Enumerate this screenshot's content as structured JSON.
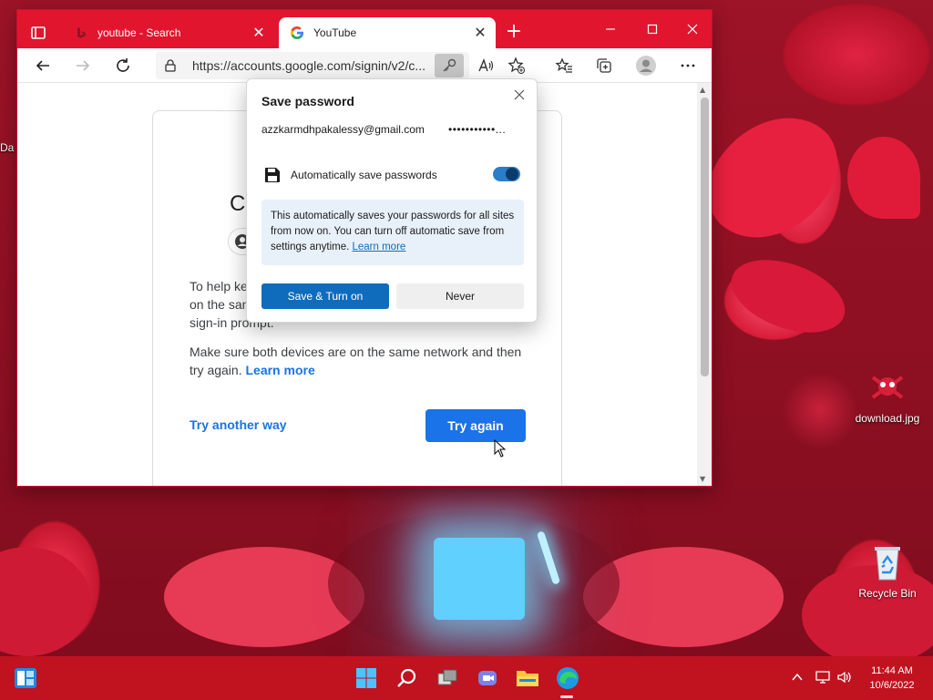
{
  "desktop": {
    "icons": [
      {
        "label": "download.jpg"
      },
      {
        "label": "Recycle Bin"
      }
    ],
    "edge_label": "Da"
  },
  "browser": {
    "tabs": [
      {
        "title": "youtube - Search",
        "favicon": "bing-favicon",
        "active": false
      },
      {
        "title": "YouTube",
        "favicon": "google-favicon",
        "active": true
      }
    ],
    "address": {
      "url": "https://accounts.google.com/signin/v2/c..."
    }
  },
  "page": {
    "heading_partial": "C",
    "para1_lines": [
      "To help ke",
      "on the san",
      "sign-in prompt."
    ],
    "para2_text": "Make sure both devices are on the same network and then try again.",
    "para2_link": "Learn more",
    "try_another": "Try another way",
    "try_again": "Try again"
  },
  "save_password": {
    "title": "Save password",
    "username": "azzkarmdhpakalessy@gmail.com",
    "password": "•••••••••••...",
    "auto_label": "Automatically save passwords",
    "auto_enabled": true,
    "info_bold": "This automatically saves your passwords for all sites from now on.",
    "info_rest": "You can turn off automatic save from settings anytime.",
    "info_link": "Learn more",
    "primary_button": "Save & Turn on",
    "secondary_button": "Never"
  },
  "taskbar": {
    "time": "11:44 AM",
    "date": "10/6/2022"
  },
  "colors": {
    "edge_accent": "#e2152e",
    "taskbar": "#c1121f",
    "google_blue": "#1a73e8",
    "edge_blue": "#0f6cbd"
  }
}
